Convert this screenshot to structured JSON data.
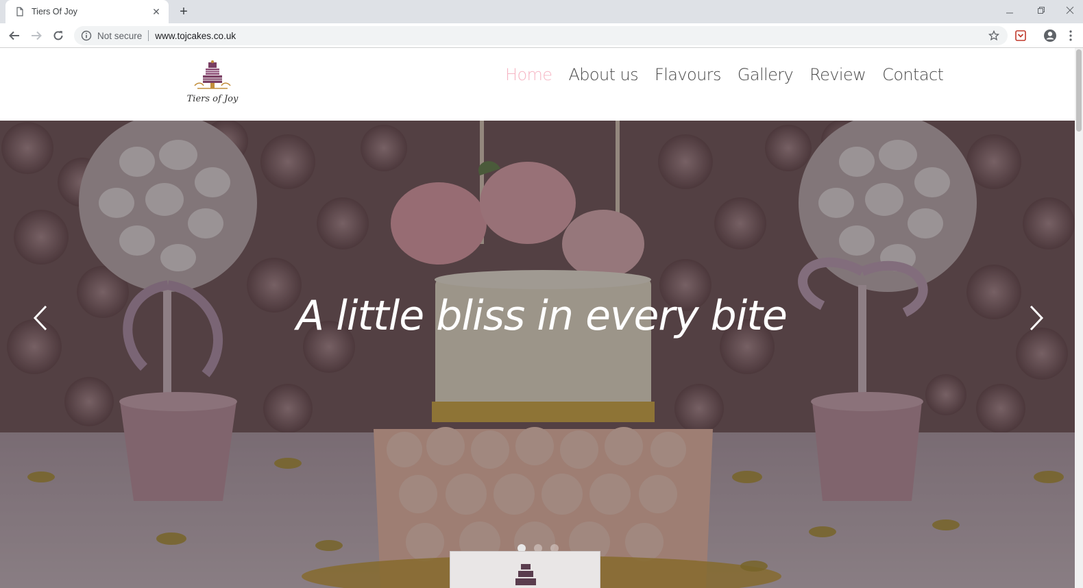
{
  "browser": {
    "tab": {
      "title": "Tiers Of Joy",
      "favicon": "page-icon",
      "close_icon": "close-icon"
    },
    "new_tab_icon": "plus-icon",
    "window_controls": [
      "minimize-icon",
      "restore-icon",
      "close-icon"
    ],
    "toolbar": {
      "back_icon": "back-arrow-icon",
      "forward_icon": "forward-arrow-icon",
      "reload_icon": "reload-icon",
      "security_label": "Not secure",
      "url": "www.tojcakes.co.uk",
      "bookmark_icon": "star-icon",
      "extension_icon": "pocket-icon",
      "profile_icon": "account-icon"
    }
  },
  "site": {
    "logo_text": "Tiers of Joy",
    "nav": {
      "items": [
        {
          "label": "Home",
          "active": true
        },
        {
          "label": "About us",
          "active": false
        },
        {
          "label": "Flavours",
          "active": false
        },
        {
          "label": "Gallery",
          "active": false
        },
        {
          "label": "Review",
          "active": false
        },
        {
          "label": "Contact",
          "active": false
        }
      ]
    },
    "hero": {
      "caption": "A little bliss in every bite",
      "prev_icon": "chevron-left-icon",
      "next_icon": "chevron-right-icon",
      "slide_count": 3,
      "active_slide": 1
    }
  },
  "colors": {
    "nav_active": "#f6b6c4",
    "nav_text": "#4a4a4a",
    "tabstrip": "#dee1e6",
    "omnibox": "#f1f3f4"
  }
}
